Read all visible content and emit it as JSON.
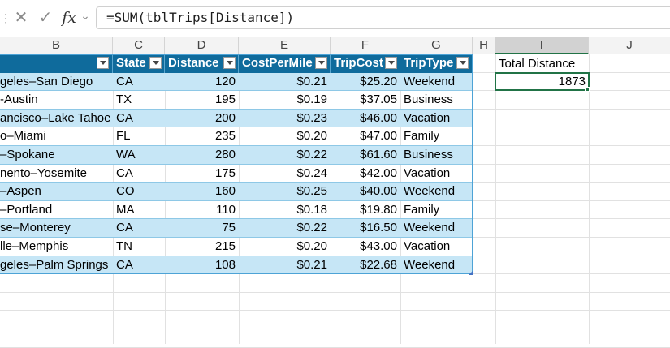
{
  "formula_bar": {
    "cancel_glyph": "✕",
    "enter_glyph": "✓",
    "fx_glyph": "fx",
    "chevron_glyph": "⌄",
    "formula": "=SUM(tblTrips[Distance])"
  },
  "columns": [
    "B",
    "C",
    "D",
    "E",
    "F",
    "G",
    "H",
    "I",
    "J"
  ],
  "selected_column": "I",
  "table": {
    "name": "tblTrips",
    "headers": [
      "",
      "State",
      "Distance",
      "CostPerMile",
      "TripCost",
      "TripType"
    ],
    "rows": [
      [
        "geles–San Diego",
        "CA",
        "120",
        "$0.21",
        "$25.20",
        "Weekend"
      ],
      [
        "-Austin",
        "TX",
        "195",
        "$0.19",
        "$37.05",
        "Business"
      ],
      [
        "ancisco–Lake Tahoe",
        "CA",
        "200",
        "$0.23",
        "$46.00",
        "Vacation"
      ],
      [
        "o–Miami",
        "FL",
        "235",
        "$0.20",
        "$47.00",
        "Family"
      ],
      [
        "–Spokane",
        "WA",
        "280",
        "$0.22",
        "$61.60",
        "Business"
      ],
      [
        "nento–Yosemite",
        "CA",
        "175",
        "$0.24",
        "$42.00",
        "Vacation"
      ],
      [
        "–Aspen",
        "CO",
        "160",
        "$0.25",
        "$40.00",
        "Weekend"
      ],
      [
        "–Portland",
        "MA",
        "110",
        "$0.18",
        "$19.80",
        "Family"
      ],
      [
        "se–Monterey",
        "CA",
        "75",
        "$0.22",
        "$16.50",
        "Weekend"
      ],
      [
        "lle–Memphis",
        "TN",
        "215",
        "$0.20",
        "$43.00",
        "Vacation"
      ],
      [
        "geles–Palm Springs",
        "CA",
        "108",
        "$0.21",
        "$22.68",
        "Weekend"
      ]
    ]
  },
  "summary": {
    "label": "Total Distance",
    "value": "1873"
  },
  "colors": {
    "header_fill": "#0f6b9c",
    "band_fill": "#c6e6f6",
    "selection": "#217346"
  }
}
